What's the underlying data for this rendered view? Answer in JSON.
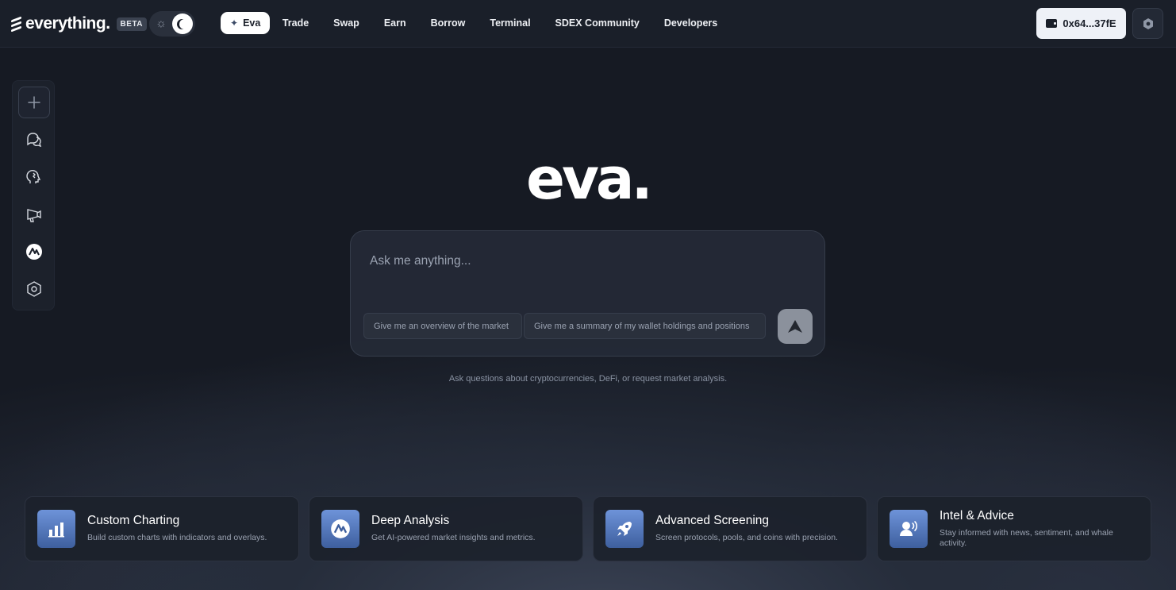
{
  "header": {
    "logo_text": "everything.",
    "beta_label": "BETA",
    "nav": [
      {
        "label": "Eva",
        "active": true
      },
      {
        "label": "Trade"
      },
      {
        "label": "Swap"
      },
      {
        "label": "Earn"
      },
      {
        "label": "Borrow"
      },
      {
        "label": "Terminal"
      },
      {
        "label": "SDEX Community"
      },
      {
        "label": "Developers"
      }
    ],
    "wallet_address": "0x64...37fE"
  },
  "sidebar": {
    "items": [
      {
        "icon": "plus-icon"
      },
      {
        "icon": "chat-bubbles-icon"
      },
      {
        "icon": "brain-head-icon"
      },
      {
        "icon": "megaphone-icon"
      },
      {
        "icon": "eva-logo-icon"
      },
      {
        "icon": "hexagon-settings-icon"
      }
    ]
  },
  "main": {
    "brand": "eva.",
    "prompt_placeholder": "Ask me anything...",
    "suggestions": [
      "Give me an overview of the market",
      "Give me a summary of my wallet holdings and positions"
    ],
    "hint": "Ask questions about cryptocurrencies, DeFi, or request market analysis."
  },
  "features": [
    {
      "title": "Custom Charting",
      "desc": "Build custom charts with indicators and overlays.",
      "icon": "bar-chart-icon"
    },
    {
      "title": "Deep Analysis",
      "desc": "Get AI-powered market insights and metrics.",
      "icon": "eva-logo-icon"
    },
    {
      "title": "Advanced Screening",
      "desc": "Screen protocols, pools, and coins with precision.",
      "icon": "rocket-icon"
    },
    {
      "title": "Intel & Advice",
      "desc": "Stay informed with news, sentiment, and whale activity.",
      "icon": "speaker-person-icon"
    }
  ],
  "colors": {
    "background": "#161a23",
    "accent": "#6e93d9",
    "card_icon_gradient_end": "#3e5f9e"
  }
}
